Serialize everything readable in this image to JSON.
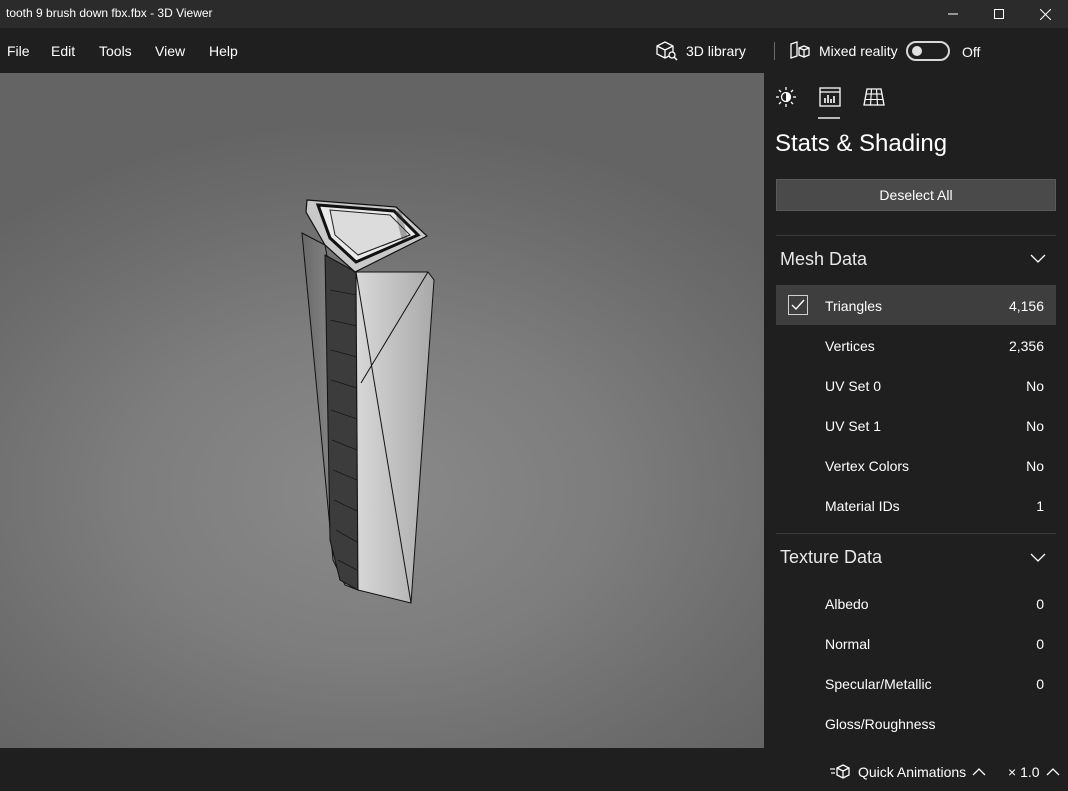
{
  "window": {
    "title": "tooth 9 brush down fbx.fbx - 3D Viewer"
  },
  "menu": {
    "items": [
      "File",
      "Edit",
      "Tools",
      "View",
      "Help"
    ]
  },
  "toolbar": {
    "library_label": "3D library",
    "mixed_reality_label": "Mixed reality",
    "mixed_reality_state": "Off"
  },
  "panel": {
    "tabs": [
      {
        "name": "lighting-tab",
        "icon": "sun-icon"
      },
      {
        "name": "stats-shading-tab",
        "icon": "stats-icon",
        "active": true
      },
      {
        "name": "grid-tab",
        "icon": "grid-icon"
      }
    ],
    "title": "Stats & Shading",
    "deselect_label": "Deselect All",
    "mesh_section": "Mesh Data",
    "mesh_rows": [
      {
        "label": "Triangles",
        "value": "4,156",
        "checked": true
      },
      {
        "label": "Vertices",
        "value": "2,356"
      },
      {
        "label": "UV Set 0",
        "value": "No"
      },
      {
        "label": "UV Set 1",
        "value": "No"
      },
      {
        "label": "Vertex Colors",
        "value": "No"
      },
      {
        "label": "Material IDs",
        "value": "1"
      }
    ],
    "texture_section": "Texture Data",
    "texture_rows": [
      {
        "label": "Albedo",
        "value": "0"
      },
      {
        "label": "Normal",
        "value": "0"
      },
      {
        "label": "Specular/Metallic",
        "value": "0"
      },
      {
        "label": "Gloss/Roughness",
        "value": ""
      }
    ]
  },
  "status": {
    "quick_animations_label": "Quick Animations",
    "speed_label": "× 1.0"
  },
  "colors": {
    "background": "#1f1f1f",
    "title_bar": "#2b2b2b",
    "selected_row": "#3e3e3e",
    "button": "#4a4a4a",
    "viewport": "#7d7d7d"
  }
}
